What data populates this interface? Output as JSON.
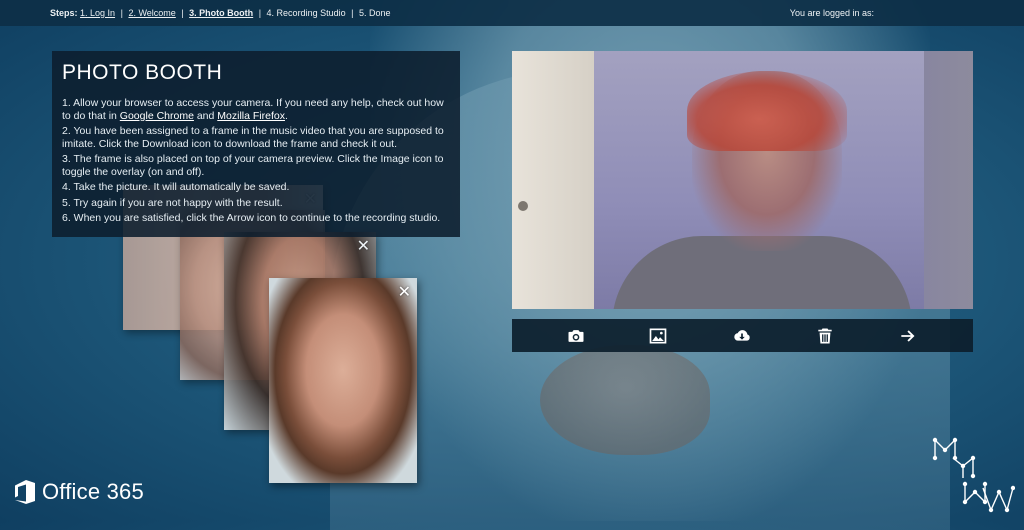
{
  "steps": {
    "label": "Steps:",
    "items": [
      {
        "text": "1. Log In",
        "link": true
      },
      {
        "text": "2. Welcome",
        "link": true
      },
      {
        "text": "3. Photo Booth",
        "link": true,
        "current": true
      },
      {
        "text": "4. Recording Studio",
        "link": false
      },
      {
        "text": "5. Done",
        "link": false
      }
    ],
    "separator": "|"
  },
  "login_status": "You are logged in as:",
  "panel": {
    "title": "PHOTO BOOTH",
    "step1_pre": "1. Allow your browser to access your camera. If you need any help, check out how to do that in ",
    "step1_link1": "Google Chrome",
    "step1_mid": " and ",
    "step1_link2": "Mozilla Firefox",
    "step1_post": ".",
    "step2": "2. You have been assigned to a frame in the music video that you are supposed to imitate. Click the Download icon to download the frame and check it out.",
    "step3": "3. The frame is also placed on top of your camera preview. Click the Image icon to toggle the overlay (on and off).",
    "step4": "4. Take the picture. It will automatically be saved.",
    "step5": "5. Try again if you are not happy with the result.",
    "step6": "6. When you are satisfied, click the Arrow icon to continue to the recording studio."
  },
  "cards": {
    "close_glyph": "✕"
  },
  "toolbar": {
    "icons": [
      "camera-icon",
      "image-icon",
      "download-icon",
      "trash-icon",
      "arrow-right-icon"
    ]
  },
  "branding": {
    "office_text": "Office 365",
    "office_color": "#e84a1c"
  },
  "colors": {
    "panel_bg": "#0c1e2d",
    "topbar_bg": "#0d2f47"
  }
}
